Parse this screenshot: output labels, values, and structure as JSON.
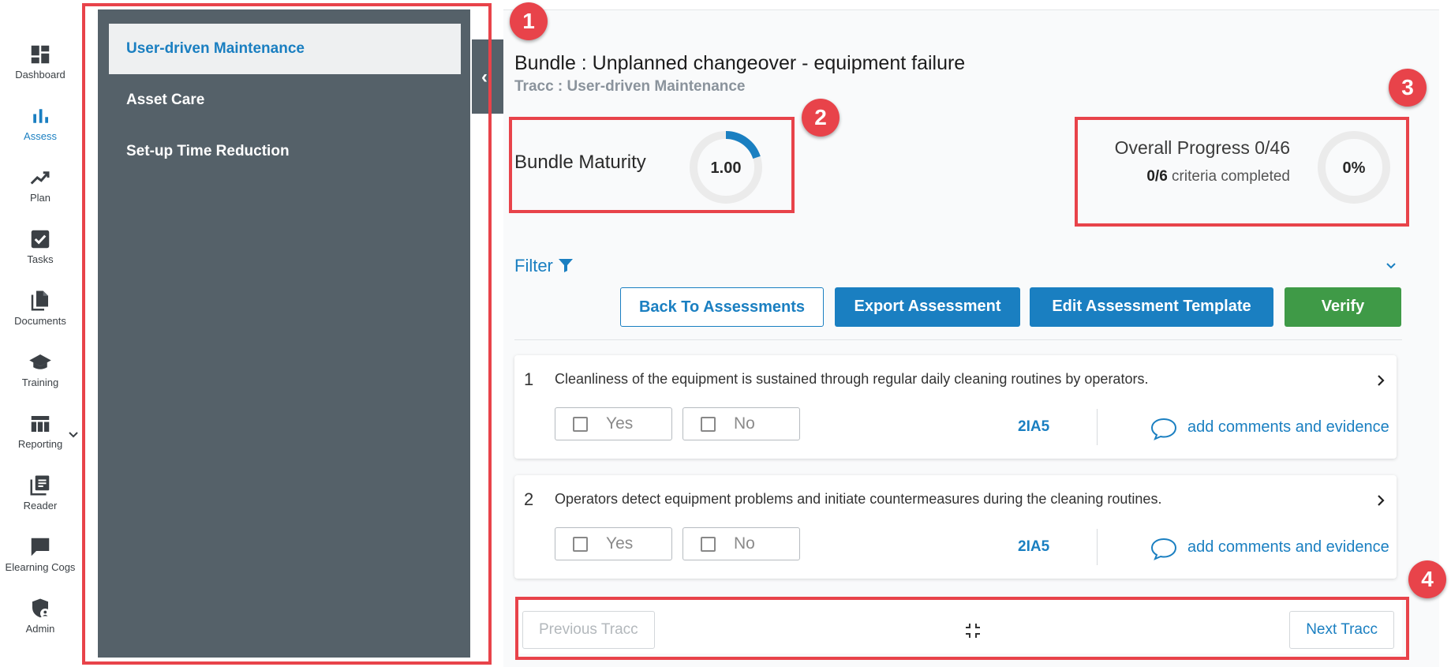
{
  "rail": {
    "items": [
      {
        "label": "Dashboard",
        "icon": "dashboard-icon"
      },
      {
        "label": "Assess",
        "icon": "bar-chart-icon",
        "active": true
      },
      {
        "label": "Plan",
        "icon": "trending-up-icon"
      },
      {
        "label": "Tasks",
        "icon": "checkbox-icon"
      },
      {
        "label": "Documents",
        "icon": "documents-icon"
      },
      {
        "label": "Training",
        "icon": "graduation-cap-icon"
      },
      {
        "label": "Reporting",
        "icon": "table-icon"
      },
      {
        "label": "Reader",
        "icon": "reader-icon"
      },
      {
        "label": "Elearning Cogs",
        "icon": "chat-icon"
      },
      {
        "label": "Admin",
        "icon": "shield-user-icon"
      }
    ]
  },
  "sidebar": {
    "items": [
      {
        "label": "User-driven Maintenance",
        "active": true
      },
      {
        "label": "Asset Care"
      },
      {
        "label": "Set-up Time Reduction"
      }
    ]
  },
  "header": {
    "title": "Bundle : Unplanned changeover - equipment failure",
    "subtitle": "Tracc : User-driven Maintenance"
  },
  "maturity": {
    "label": "Bundle Maturity",
    "value": "1.00",
    "fill_fraction": 0.2
  },
  "progress": {
    "title": "Overall Progress 0/46",
    "criteria_count": "0/6",
    "criteria_text": " criteria completed",
    "percent": "0%",
    "fill_fraction": 0
  },
  "filter": {
    "label": "Filter"
  },
  "actions": {
    "back": "Back To Assessments",
    "export": "Export Assessment",
    "edit": "Edit Assessment Template",
    "verify": "Verify"
  },
  "criteria": [
    {
      "num": "1",
      "text": "Cleanliness of the equipment is sustained through regular daily cleaning routines by operators.",
      "yes": "Yes",
      "no": "No",
      "code": "2IA5",
      "comment": "add comments and evidence"
    },
    {
      "num": "2",
      "text": "Operators detect equipment problems and initiate countermeasures during the cleaning routines.",
      "yes": "Yes",
      "no": "No",
      "code": "2IA5",
      "comment": "add comments and evidence"
    }
  ],
  "navigation": {
    "previous": "Previous Tracc",
    "next": "Next Tracc"
  },
  "annotations": [
    "1",
    "2",
    "3",
    "4"
  ],
  "colors": {
    "accent": "#1a7fc1",
    "sidebar": "#556169",
    "verify": "#3f9a47",
    "annotation": "#e8434a"
  }
}
